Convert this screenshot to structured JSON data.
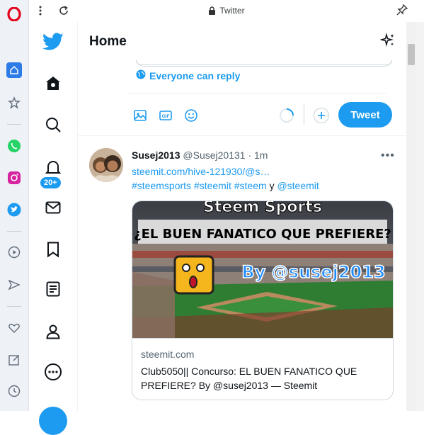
{
  "browser": {
    "title": "Twitter",
    "sidebar_icons": [
      "opera-logo",
      "home-icon",
      "star-icon",
      "whatsapp-icon",
      "instagram-icon",
      "twitter-icon",
      "player-icon",
      "send-icon",
      "heart-icon",
      "pin-icon",
      "history-icon"
    ]
  },
  "twitter": {
    "badge_count": "20+",
    "header_title": "Home",
    "reply_setting": "Everyone can reply",
    "tweet_button": "Tweet",
    "tweet": {
      "name": "Susej2013",
      "handle": "@Susej20131",
      "time": "· 1m",
      "link": "steemit.com/hive-121930/@s…",
      "hashtags": [
        "#steemsports",
        "#steemit",
        "#steem"
      ],
      "conj": "y",
      "mention": "@steemit",
      "image_text": {
        "top": "Steem Sports",
        "middle": "¿EL BUEN FANATICO QUE PREFIERE?",
        "by": "By @susej2013"
      },
      "card_domain": "steemit.com",
      "card_title": "Club5050|| Concurso: EL BUEN FANATICO QUE PREFIERE? By @susej2013 — Steemit"
    }
  },
  "colors": {
    "accent": "#1d9bf0",
    "text": "#0f1419",
    "muted": "#536471"
  }
}
